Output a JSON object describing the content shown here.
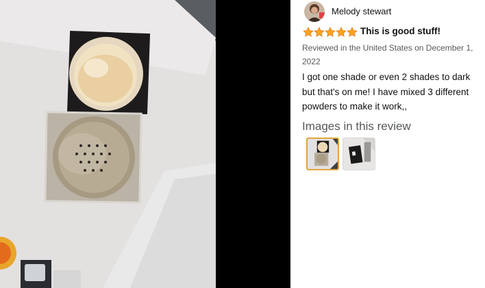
{
  "review": {
    "reviewer_name": "Melody stewart",
    "rating": 5,
    "rating_max": 5,
    "title": "This is good stuff!",
    "meta": "Reviewed in the United States on December 1, 2022",
    "body": "I got one shade or even 2 shades to dark but that's on me! I have mixed 3 different powders to make it work,,"
  },
  "images_section": {
    "heading": "Images in this review",
    "thumbnails": [
      {
        "selected": true
      },
      {
        "selected": false
      }
    ]
  },
  "colors": {
    "star": "#ffa41c",
    "thumb_selected_border": "#e0a640",
    "text": "#0f1111",
    "muted": "#565959"
  },
  "icons": {
    "star": "star-icon",
    "avatar": "avatar"
  }
}
